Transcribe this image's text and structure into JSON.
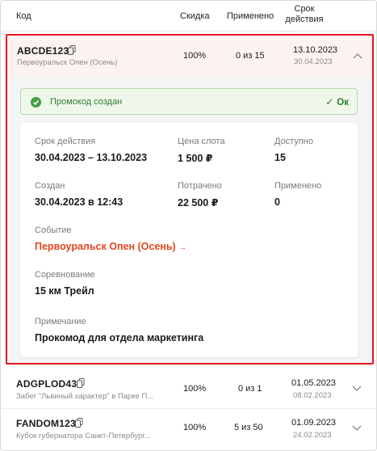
{
  "header": {
    "code": "Код",
    "discount": "Скидка",
    "used": "Применено",
    "valid_line1": "Срок",
    "valid_line2": "действия"
  },
  "selected": {
    "code": "ABCDE123",
    "event": "Первоуральск Опен (Осень)",
    "discount": "100%",
    "used": "0 из 15",
    "valid_to": "13.10.2023",
    "valid_from": "30.04.2023",
    "banner": {
      "message": "Промокод создан",
      "ok_label": "Ок"
    },
    "details": {
      "validity_label": "Срок действия",
      "validity_value": "30.04.2023 – 13.10.2023",
      "slot_price_label": "Цена слота",
      "slot_price_value": "1 500 ₽",
      "available_label": "Доступно",
      "available_value": "15",
      "created_label": "Создан",
      "created_value": "30.04.2023 в 12:43",
      "spent_label": "Потрачено",
      "spent_value": "22 500 ₽",
      "applied_label": "Применено",
      "applied_value": "0",
      "event_label": "Событие",
      "event_value": "Первоуральск Опен (Осень)",
      "competition_label": "Соревнование",
      "competition_value": "15 км Трейл",
      "note_label": "Примечание",
      "note_value": "Прокомод для отдела маркетинга"
    }
  },
  "rows": [
    {
      "code": "ADGPLOD43",
      "event": "Забег \"Львиный характер\" в Парке П...",
      "discount": "100%",
      "used": "0 из 1",
      "valid_to": "01.05.2023",
      "valid_from": "08.02.2023"
    },
    {
      "code": "FANDOM123",
      "event": "Кубок губернатора Санкт-Петербург...",
      "discount": "100%",
      "used": "5 из 50",
      "valid_to": "01.09.2023",
      "valid_from": "24.02.2023"
    }
  ],
  "colors": {
    "highlight_border": "#e3161b",
    "link": "#e0461f",
    "success": "#2e7d32"
  }
}
